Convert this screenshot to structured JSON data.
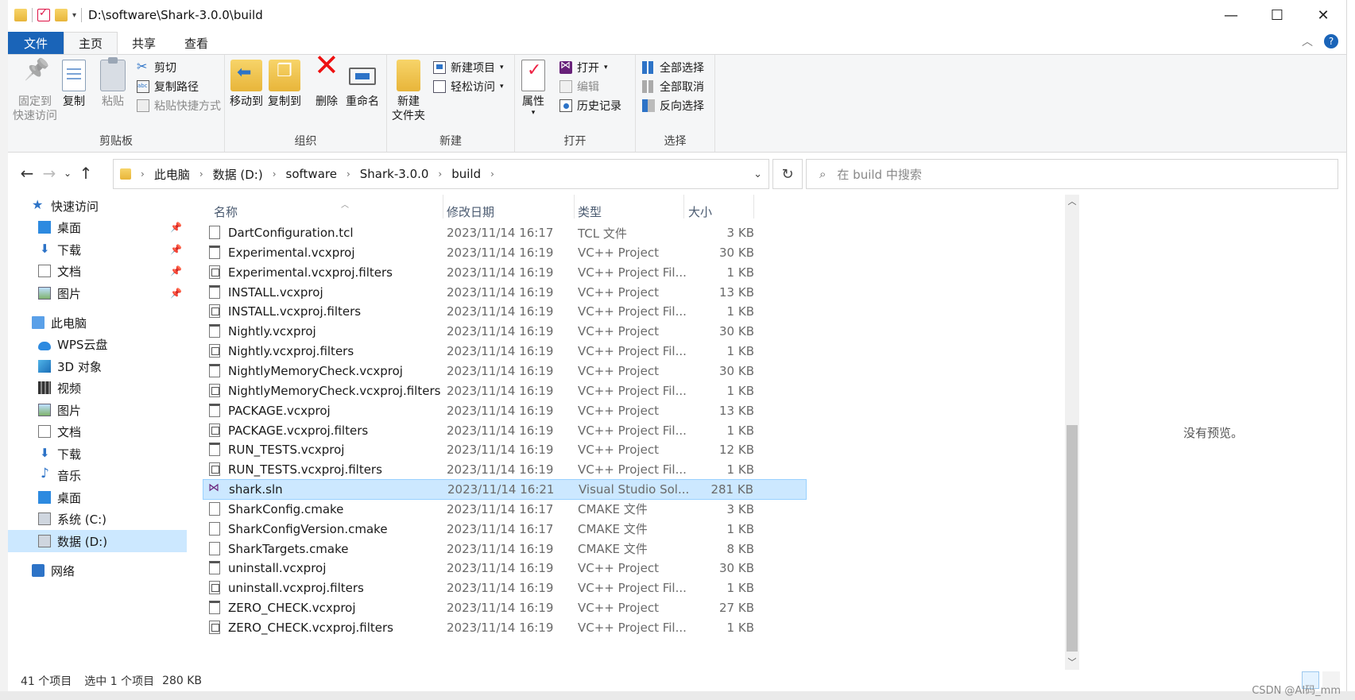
{
  "window": {
    "title": "D:\\software\\Shark-3.0.0\\build",
    "minimize": "—",
    "maximize": "☐",
    "close": "✕"
  },
  "ribbon_tabs": [
    "文件",
    "主页",
    "共享",
    "查看"
  ],
  "ribbon": {
    "clipboard": {
      "label": "剪贴板",
      "pin_line1": "固定到",
      "pin_line2": "快速访问",
      "copy": "复制",
      "paste": "粘贴",
      "cut": "剪切",
      "copy_path": "复制路径",
      "paste_shortcut": "粘贴快捷方式"
    },
    "organize": {
      "label": "组织",
      "move_to": "移动到",
      "copy_to": "复制到",
      "delete": "删除",
      "rename": "重命名"
    },
    "new": {
      "label": "新建",
      "new_folder_line1": "新建",
      "new_folder_line2": "文件夹",
      "new_item": "新建项目",
      "easy_access": "轻松访问"
    },
    "open": {
      "label": "打开",
      "properties": "属性",
      "open": "打开",
      "edit": "编辑",
      "history": "历史记录"
    },
    "select": {
      "label": "选择",
      "select_all": "全部选择",
      "select_none": "全部取消",
      "invert": "反向选择"
    }
  },
  "address": {
    "segments": [
      "此电脑",
      "数据 (D:)",
      "software",
      "Shark-3.0.0",
      "build"
    ],
    "search_placeholder": "在 build 中搜索"
  },
  "nav": {
    "quick_access": "快速访问",
    "quick_items": [
      "桌面",
      "下载",
      "文档",
      "图片"
    ],
    "this_pc": "此电脑",
    "pc_items": [
      "WPS云盘",
      "3D 对象",
      "视频",
      "图片",
      "文档",
      "下载",
      "音乐",
      "桌面",
      "系统 (C:)",
      "数据 (D:)"
    ],
    "network": "网络"
  },
  "columns": {
    "name": "名称",
    "date": "修改日期",
    "type": "类型",
    "size": "大小"
  },
  "files": [
    {
      "name": "DartConfiguration.tcl",
      "date": "2023/11/14 16:17",
      "type": "TCL 文件",
      "size": "3 KB",
      "icon": "file"
    },
    {
      "name": "Experimental.vcxproj",
      "date": "2023/11/14 16:19",
      "type": "VC++ Project",
      "size": "30 KB",
      "icon": "vcxproj"
    },
    {
      "name": "Experimental.vcxproj.filters",
      "date": "2023/11/14 16:19",
      "type": "VC++ Project Fil...",
      "size": "1 KB",
      "icon": "filters"
    },
    {
      "name": "INSTALL.vcxproj",
      "date": "2023/11/14 16:19",
      "type": "VC++ Project",
      "size": "13 KB",
      "icon": "vcxproj"
    },
    {
      "name": "INSTALL.vcxproj.filters",
      "date": "2023/11/14 16:19",
      "type": "VC++ Project Fil...",
      "size": "1 KB",
      "icon": "filters"
    },
    {
      "name": "Nightly.vcxproj",
      "date": "2023/11/14 16:19",
      "type": "VC++ Project",
      "size": "30 KB",
      "icon": "vcxproj"
    },
    {
      "name": "Nightly.vcxproj.filters",
      "date": "2023/11/14 16:19",
      "type": "VC++ Project Fil...",
      "size": "1 KB",
      "icon": "filters"
    },
    {
      "name": "NightlyMemoryCheck.vcxproj",
      "date": "2023/11/14 16:19",
      "type": "VC++ Project",
      "size": "30 KB",
      "icon": "vcxproj"
    },
    {
      "name": "NightlyMemoryCheck.vcxproj.filters",
      "date": "2023/11/14 16:19",
      "type": "VC++ Project Fil...",
      "size": "1 KB",
      "icon": "filters"
    },
    {
      "name": "PACKAGE.vcxproj",
      "date": "2023/11/14 16:19",
      "type": "VC++ Project",
      "size": "13 KB",
      "icon": "vcxproj"
    },
    {
      "name": "PACKAGE.vcxproj.filters",
      "date": "2023/11/14 16:19",
      "type": "VC++ Project Fil...",
      "size": "1 KB",
      "icon": "filters"
    },
    {
      "name": "RUN_TESTS.vcxproj",
      "date": "2023/11/14 16:19",
      "type": "VC++ Project",
      "size": "12 KB",
      "icon": "vcxproj"
    },
    {
      "name": "RUN_TESTS.vcxproj.filters",
      "date": "2023/11/14 16:19",
      "type": "VC++ Project Fil...",
      "size": "1 KB",
      "icon": "filters"
    },
    {
      "name": "shark.sln",
      "date": "2023/11/14 16:21",
      "type": "Visual Studio Sol...",
      "size": "281 KB",
      "icon": "sln",
      "selected": true
    },
    {
      "name": "SharkConfig.cmake",
      "date": "2023/11/14 16:17",
      "type": "CMAKE 文件",
      "size": "3 KB",
      "icon": "file"
    },
    {
      "name": "SharkConfigVersion.cmake",
      "date": "2023/11/14 16:17",
      "type": "CMAKE 文件",
      "size": "1 KB",
      "icon": "file"
    },
    {
      "name": "SharkTargets.cmake",
      "date": "2023/11/14 16:19",
      "type": "CMAKE 文件",
      "size": "8 KB",
      "icon": "file"
    },
    {
      "name": "uninstall.vcxproj",
      "date": "2023/11/14 16:19",
      "type": "VC++ Project",
      "size": "30 KB",
      "icon": "vcxproj"
    },
    {
      "name": "uninstall.vcxproj.filters",
      "date": "2023/11/14 16:19",
      "type": "VC++ Project Fil...",
      "size": "1 KB",
      "icon": "filters"
    },
    {
      "name": "ZERO_CHECK.vcxproj",
      "date": "2023/11/14 16:19",
      "type": "VC++ Project",
      "size": "27 KB",
      "icon": "vcxproj"
    },
    {
      "name": "ZERO_CHECK.vcxproj.filters",
      "date": "2023/11/14 16:19",
      "type": "VC++ Project Fil...",
      "size": "1 KB",
      "icon": "filters"
    }
  ],
  "preview": {
    "empty_text": "没有预览。"
  },
  "status": {
    "count": "41 个项目",
    "selected": "选中 1 个项目",
    "selected_size": "280 KB"
  },
  "watermark": "CSDN @AI码_mm",
  "colors": {
    "accent": "#1a64b8",
    "selection": "#cce8ff"
  }
}
